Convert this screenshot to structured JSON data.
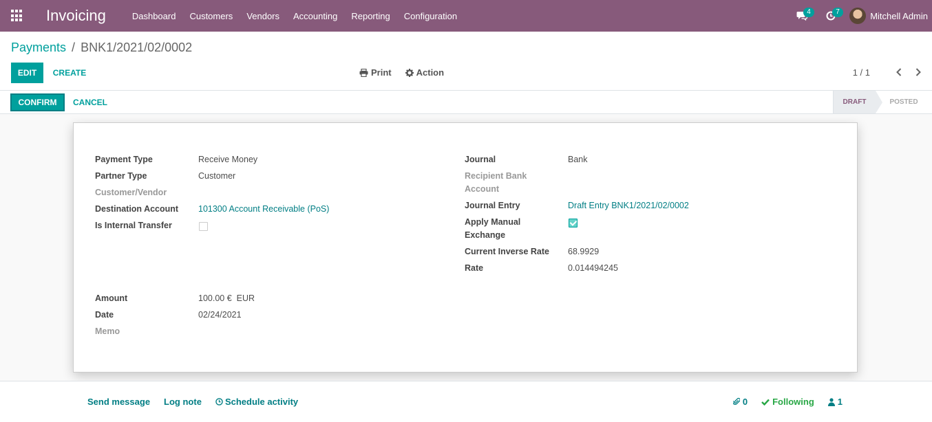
{
  "navbar": {
    "app_name": "Invoicing",
    "menu": [
      "Dashboard",
      "Customers",
      "Vendors",
      "Accounting",
      "Reporting",
      "Configuration"
    ],
    "messages_count": "4",
    "activities_count": "7",
    "user_name": "Mitchell Admin"
  },
  "breadcrumb": {
    "parent": "Payments",
    "separator": "/",
    "current": "BNK1/2021/02/0002"
  },
  "toolbar": {
    "edit_label": "EDIT",
    "create_label": "CREATE",
    "print_label": "Print",
    "action_label": "Action",
    "pager": "1 / 1"
  },
  "statusbar": {
    "confirm_label": "CONFIRM",
    "cancel_label": "CANCEL",
    "stages": [
      "DRAFT",
      "POSTED"
    ],
    "current_stage": "DRAFT"
  },
  "form": {
    "payment_type_label": "Payment Type",
    "payment_type": "Receive Money",
    "partner_type_label": "Partner Type",
    "partner_type": "Customer",
    "customer_vendor_label": "Customer/Vendor",
    "destination_account_label": "Destination Account",
    "destination_account": "101300 Account Receivable (PoS)",
    "internal_transfer_label": "Is Internal Transfer",
    "internal_transfer": false,
    "amount_label": "Amount",
    "amount": "100.00 €  EUR",
    "date_label": "Date",
    "date": "02/24/2021",
    "memo_label": "Memo",
    "journal_label": "Journal",
    "journal": "Bank",
    "recipient_bank_label_1": "Recipient Bank",
    "recipient_bank_label_2": "Account",
    "journal_entry_label": "Journal Entry",
    "journal_entry": "Draft Entry BNK1/2021/02/0002",
    "manual_exchange_label_1": "Apply Manual",
    "manual_exchange_label_2": "Exchange",
    "manual_exchange": true,
    "inverse_rate_label": "Current Inverse Rate",
    "inverse_rate": "68.9929",
    "rate_label": "Rate",
    "rate": "0.014494245"
  },
  "chatter": {
    "send_message": "Send message",
    "log_note": "Log note",
    "schedule_activity": "Schedule activity",
    "attachments": "0",
    "following": "Following",
    "followers": "1"
  },
  "colors": {
    "brand": "#875a7b",
    "accent": "#00a09d",
    "link": "#017e84",
    "following": "#28a745"
  }
}
